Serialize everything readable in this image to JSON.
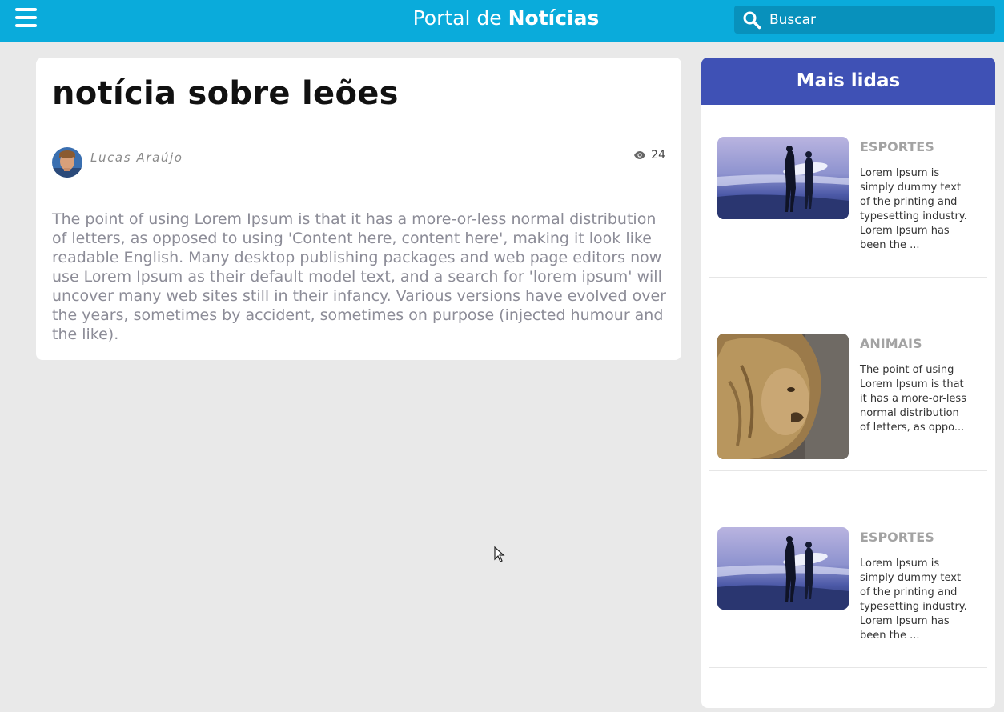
{
  "header": {
    "brand_prefix": "Portal de ",
    "brand_bold": "Notícias",
    "search_placeholder": "Buscar",
    "icons": {
      "menu": "hamburger-icon",
      "search": "search-icon"
    }
  },
  "article": {
    "title": "notícia sobre leões",
    "author": "Lucas Araújo",
    "views": "24",
    "body": "The point of using Lorem Ipsum is that it has a more-or-less normal distribution of letters, as opposed to using 'Content here, content here', making it look like readable English. Many desktop publishing packages and web page editors now use Lorem Ipsum as their default model text, and a search for 'lorem ipsum' will uncover many web sites still in their infancy. Various versions have evolved over the years, sometimes by accident, sometimes on purpose (injected humour and the like)."
  },
  "sidebar": {
    "title": "Mais lidas",
    "items": [
      {
        "category": "ESPORTES",
        "excerpt": "Lorem Ipsum is simply dummy text of the printing and typesetting industry. Lorem Ipsum has been the ...",
        "image": "surfers-beach"
      },
      {
        "category": "ANIMAIS",
        "excerpt": "The point of using Lorem Ipsum is that it has a more-or-less normal distribution of letters, as oppo...",
        "image": "lion"
      },
      {
        "category": "ESPORTES",
        "excerpt": "Lorem Ipsum is simply dummy text of the printing and typesetting industry. Lorem Ipsum has been the ...",
        "image": "surfers-beach"
      }
    ]
  },
  "colors": {
    "topbar": "#0aabdb",
    "search_bg": "#0891bc",
    "sidebar_header": "#3f51b5",
    "page_bg": "#e9e9e9"
  }
}
